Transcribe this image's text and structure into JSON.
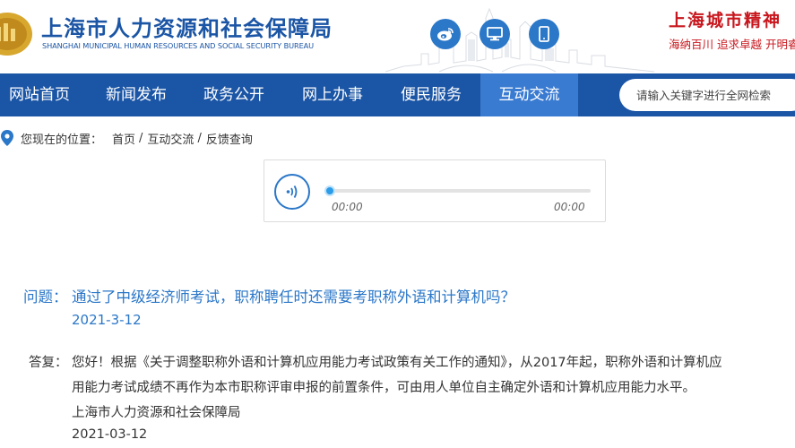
{
  "header": {
    "title_cn": "上海市人力资源和社会保障局",
    "title_en": "SHANGHAI MUNICIPAL HUMAN RESOURCES AND SOCIAL SECURITY BUREAU",
    "icons": [
      "weibo-icon",
      "computer-icon",
      "mobile-icon"
    ],
    "spirit_title": "上海城市精神",
    "spirit_sub": "海纳百川  追求卓越  开明睿智"
  },
  "nav": {
    "items": [
      "网站首页",
      "新闻发布",
      "政务公开",
      "网上办事",
      "便民服务",
      "互动交流"
    ],
    "active_index": 5
  },
  "search": {
    "placeholder": "请输入关键字进行全网检索"
  },
  "breadcrumb": {
    "label": "您现在的位置：",
    "items": [
      "首页",
      "互动交流",
      "反馈查询"
    ]
  },
  "player": {
    "current_time": "00:00",
    "duration": "00:00",
    "progress": 0
  },
  "qa": {
    "question_label": "问题：",
    "question": "通过了中级经济师考试，职称聘任时还需要考职称外语和计算机吗？",
    "question_date": "2021-3-12",
    "answer_label": "答复：",
    "answer_lines": [
      "您好！根据《关于调整职称外语和计算机应用能力考试政策有关工作的通知》，从2017年起，职称外语和计算机应",
      "用能力考试成绩不再作为本市职称评审申报的前置条件，可由用人单位自主确定外语和计算机应用能力水平。",
      "上海市人力资源和社会保障局",
      "2021-03-12"
    ]
  },
  "colors": {
    "primary": "#1b55a5",
    "nav_active": "#3a7bd2",
    "accent_blue": "#2b77c8",
    "spirit_red": "#c8161d"
  }
}
